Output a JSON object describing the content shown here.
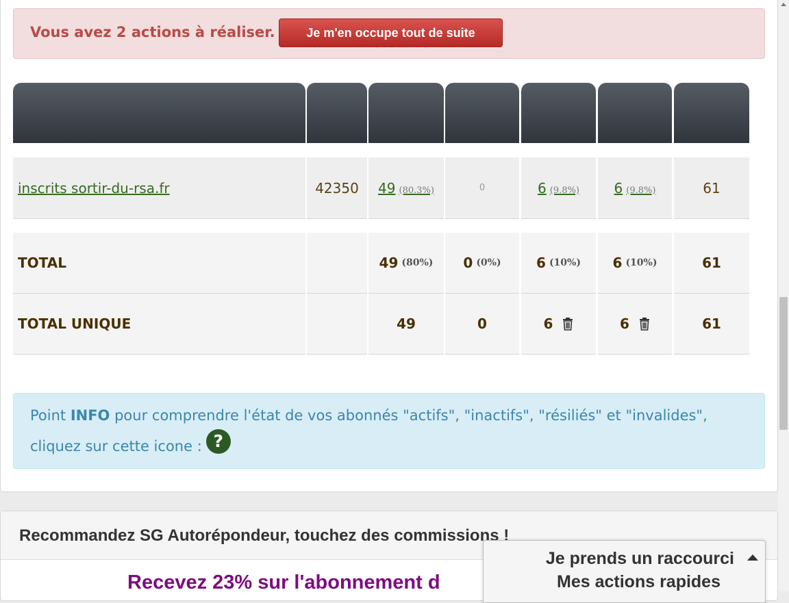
{
  "alert": {
    "text": "Vous avez 2 actions à réaliser.",
    "button_label": "Je m'en occupe tout de suite"
  },
  "table": {
    "rows": [
      {
        "name": "inscrits sortir-du-rsa.fr",
        "id": "42350",
        "actifs": "49",
        "actifs_pct": "(80.3%)",
        "inactifs": "0",
        "resilies": "6",
        "resilies_pct": "(9.8%)",
        "invalides": "6",
        "invalides_pct": "(9.8%)",
        "total": "61"
      }
    ],
    "total": {
      "label": "TOTAL",
      "actifs": "49",
      "actifs_pct": "(80%)",
      "inactifs": "0",
      "inactifs_pct": "(0%)",
      "resilies": "6",
      "resilies_pct": "(10%)",
      "invalides": "6",
      "invalides_pct": "(10%)",
      "total": "61"
    },
    "total_unique": {
      "label": "TOTAL UNIQUE",
      "actifs": "49",
      "inactifs": "0",
      "resilies": "6",
      "invalides": "6",
      "total": "61"
    }
  },
  "info": {
    "prefix": "Point ",
    "bold": "INFO",
    "line1_rest": " pour comprendre l'état de vos abonnés \"actifs\", \"inactifs\", \"résiliés\" et \"invalides\",",
    "line2": "cliquez sur cette icone :",
    "help_glyph": "?"
  },
  "recommend": {
    "title": "Recommandez SG Autorépondeur, touchez des commissions !",
    "promo": "Recevez 23% sur l'abonnement d"
  },
  "quick_actions": {
    "title": "Je prends un raccourci",
    "subtitle": "Mes actions rapides"
  },
  "icons": {
    "help": "question-circle-icon",
    "trash": "trash-icon",
    "caret": "caret-up-icon"
  },
  "colors": {
    "alert_bg": "#f2dede",
    "alert_text": "#b94a48",
    "button": "#c9302c",
    "info_bg": "#d9edf7",
    "info_text": "#3a87ad",
    "link": "#356a1f",
    "promo": "#7e0b80"
  }
}
